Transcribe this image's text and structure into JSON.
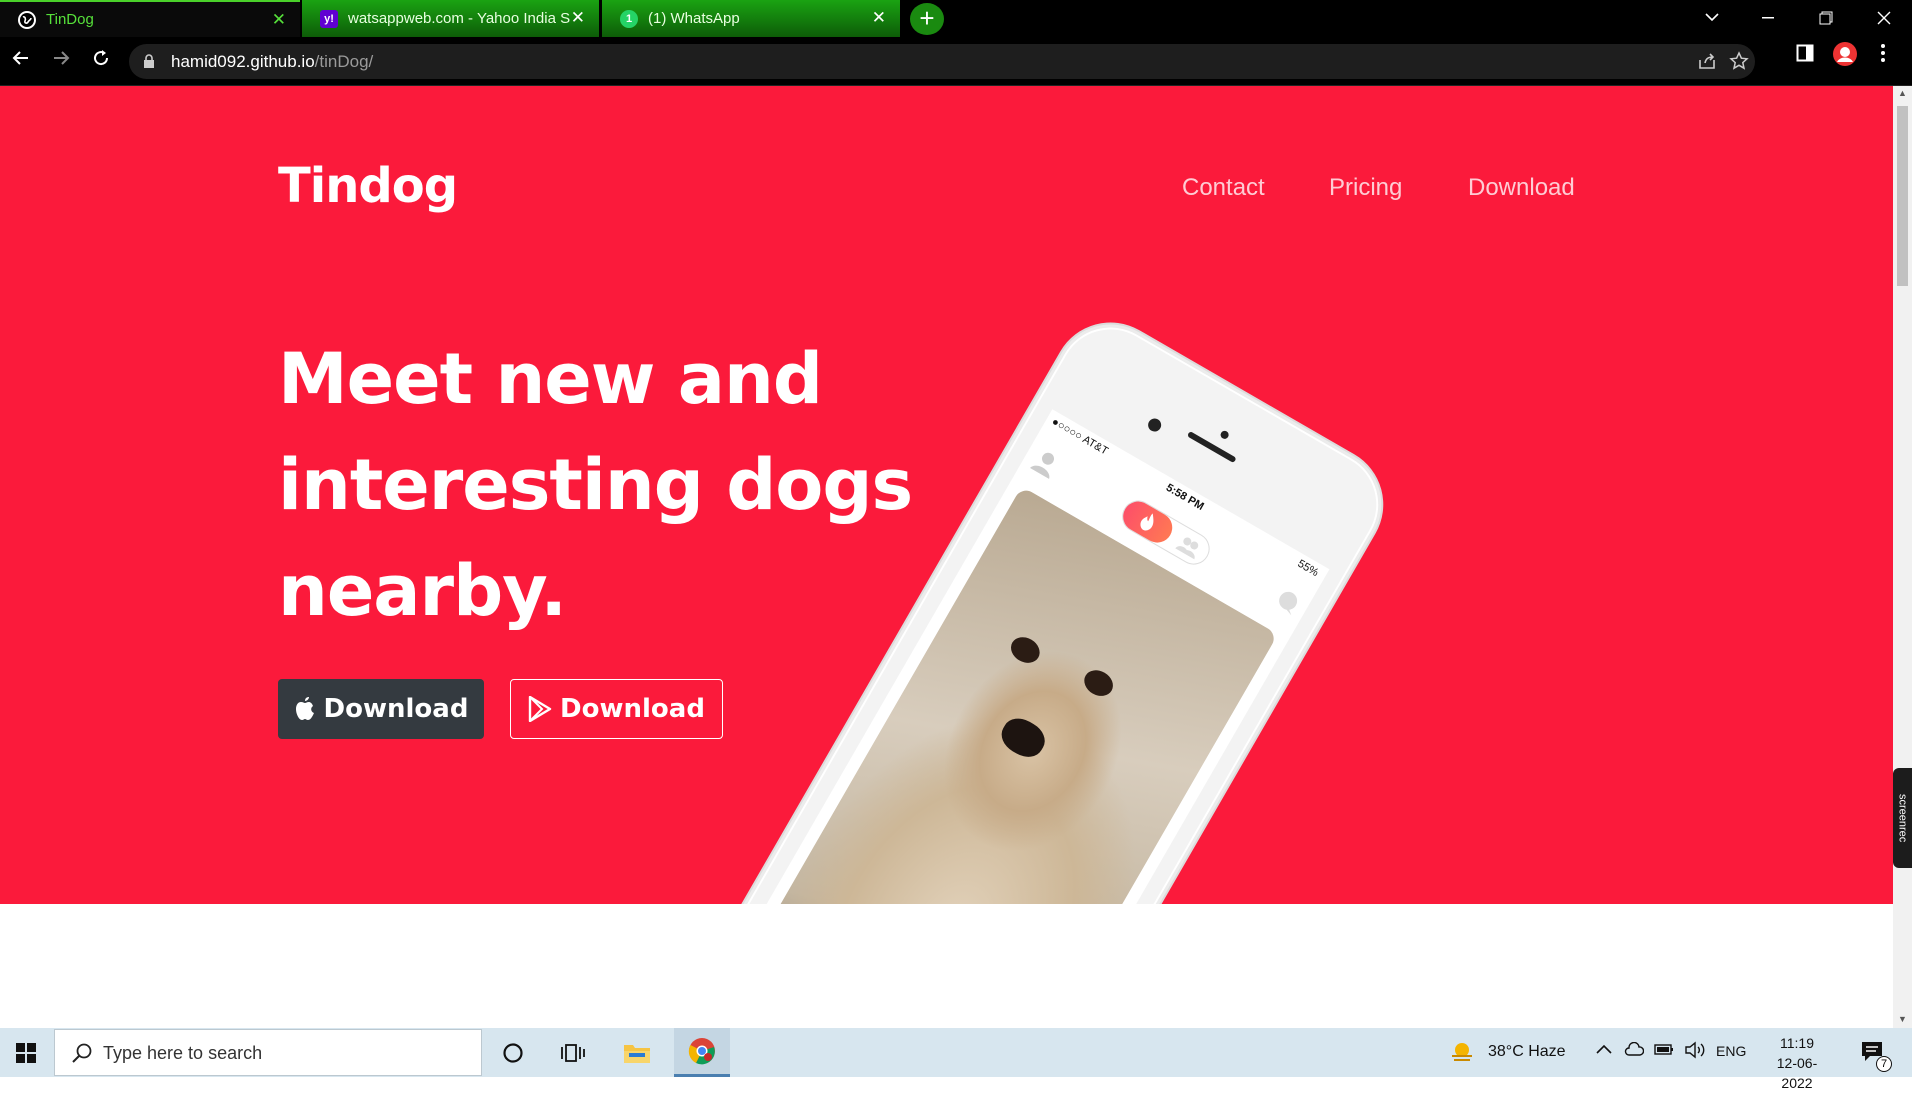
{
  "browser": {
    "tabs": [
      {
        "title": "TinDog",
        "active": true,
        "icon": "globe-icon"
      },
      {
        "title": "watsappweb.com - Yahoo India S",
        "active": false,
        "icon": "yahoo-icon"
      },
      {
        "title": "(1) WhatsApp",
        "active": false,
        "icon": "whatsapp-icon"
      }
    ],
    "url_host": "hamid092.github.io",
    "url_path": "/tinDog/"
  },
  "page": {
    "brand": "Tindog",
    "nav": [
      "Contact",
      "Pricing",
      "Download"
    ],
    "headline_lines": [
      "Meet new and",
      "interesting dogs",
      "nearby."
    ],
    "buttons": {
      "apple_download": "Download",
      "play_download": "Download"
    },
    "phone": {
      "carrier": "●○○○○ AT&T",
      "time": "5:58 PM",
      "battery": "55%"
    },
    "colors": {
      "hero": "#fb1a3b",
      "dark_button": "#343a40"
    }
  },
  "side_tab": "screenrec",
  "taskbar": {
    "search_placeholder": "Type here to search",
    "weather": "38°C  Haze",
    "language": "ENG",
    "time": "11:19",
    "date": "12-06-2022",
    "notification_count": "7"
  }
}
